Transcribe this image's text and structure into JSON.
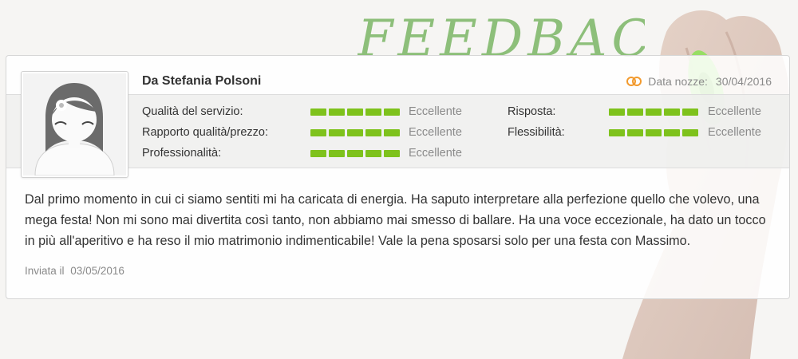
{
  "banner": {
    "title": "FEEDBACK"
  },
  "review": {
    "author": "Da Stefania Polsoni",
    "wedding_date_label": "Data nozze:",
    "wedding_date": "30/04/2016",
    "ratings_left": [
      {
        "label": "Qualità del servizio:",
        "value": "Eccellente",
        "score": 5
      },
      {
        "label": "Rapporto qualità/prezzo:",
        "value": "Eccellente",
        "score": 5
      },
      {
        "label": "Professionalità:",
        "value": "Eccellente",
        "score": 5
      }
    ],
    "ratings_right": [
      {
        "label": "Risposta:",
        "value": "Eccellente",
        "score": 5
      },
      {
        "label": "Flessibilità:",
        "value": "Eccellente",
        "score": 5
      }
    ],
    "text": "Dal primo momento in cui ci siamo sentiti mi ha caricata di energia. Ha saputo interpretare alla perfezione quello che volevo, una mega festa! Non mi sono mai divertita così tanto, non abbiamo mai smesso di ballare. Ha una voce eccezionale, ha dato un tocco in più all'aperitivo e ha reso il mio matrimonio indimenticabile! Vale la pena sposarsi solo per una festa con Massimo.",
    "sent_label": "Inviata il",
    "sent_date": "03/05/2016"
  },
  "colors": {
    "bar_fill": "#7ec21c",
    "title_green": "#8dbf7a",
    "rings_orange": "#f29a2e",
    "marker_green": "#8fe05a"
  }
}
